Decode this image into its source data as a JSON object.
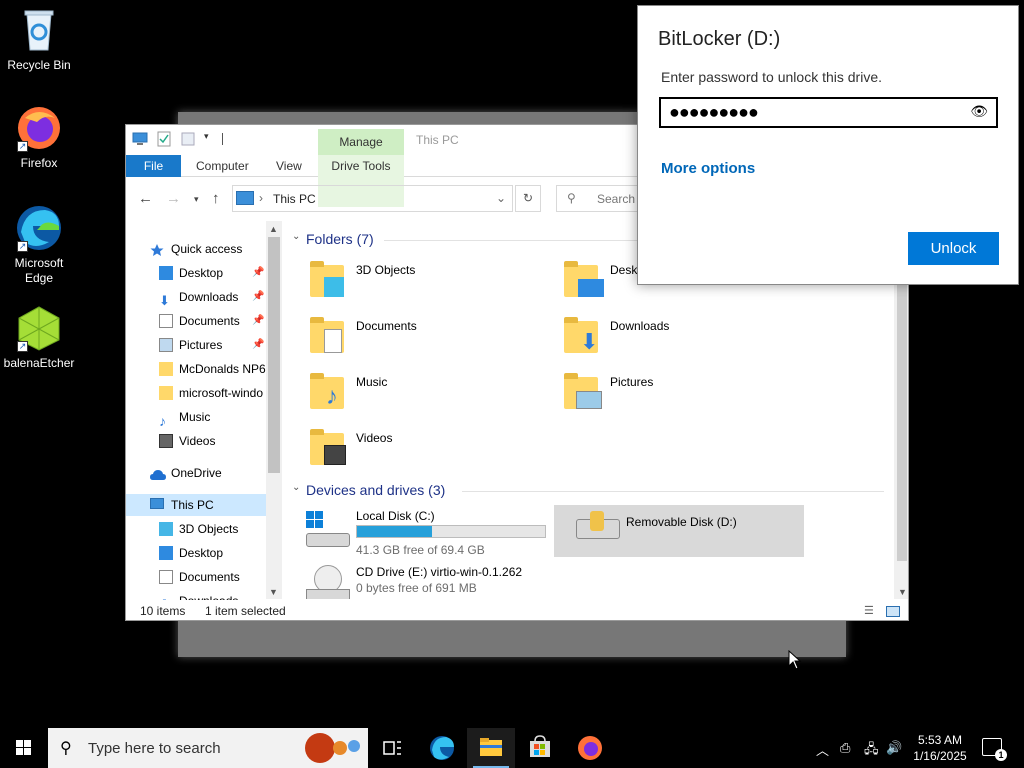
{
  "desktop": {
    "icons": [
      {
        "label": "Recycle Bin"
      },
      {
        "label": "Firefox"
      },
      {
        "label": "Microsoft Edge"
      },
      {
        "label": "balenaEtcher"
      }
    ]
  },
  "explorer": {
    "title": "This PC",
    "manage_tab": "Manage",
    "ribbon_tabs": {
      "file": "File",
      "computer": "Computer",
      "view": "View",
      "drive_tools": "Drive Tools"
    },
    "address": {
      "path": "This PC"
    },
    "search": {
      "placeholder": "Search T"
    },
    "nav": {
      "quick_access": "Quick access",
      "items": [
        "Desktop",
        "Downloads",
        "Documents",
        "Pictures",
        "McDonalds NP6",
        "microsoft-windo",
        "Music",
        "Videos"
      ],
      "onedrive": "OneDrive",
      "this_pc": "This PC",
      "this_pc_items": [
        "3D Objects",
        "Desktop",
        "Documents",
        "Downloads"
      ]
    },
    "folders_header": "Folders (7)",
    "folders": [
      "3D Objects",
      "Desktop",
      "Documents",
      "Downloads",
      "Music",
      "Pictures",
      "Videos"
    ],
    "devices_header": "Devices and drives (3)",
    "drives": [
      {
        "name": "Local Disk (C:)",
        "free": "41.3 GB free of 69.4 GB",
        "used_fraction": 0.4
      },
      {
        "name": "Removable Disk (D:)"
      },
      {
        "name": "CD Drive (E:) virtio-win-0.1.262",
        "free": "0 bytes free of 691 MB"
      }
    ],
    "status": {
      "items": "10 items",
      "selected": "1 item selected"
    }
  },
  "bitlocker": {
    "title": "BitLocker (D:)",
    "prompt": "Enter password to unlock this drive.",
    "password_mask": "●●●●●●●●●",
    "more_options": "More options",
    "unlock": "Unlock"
  },
  "taskbar": {
    "search_placeholder": "Type here to search",
    "time": "5:53 AM",
    "date": "1/16/2025",
    "notification_count": "1"
  },
  "colors": {
    "accent": "#0078d7",
    "link": "#0067b8",
    "file_tab": "#1979ca",
    "manage_tab": "#cfeec4"
  }
}
